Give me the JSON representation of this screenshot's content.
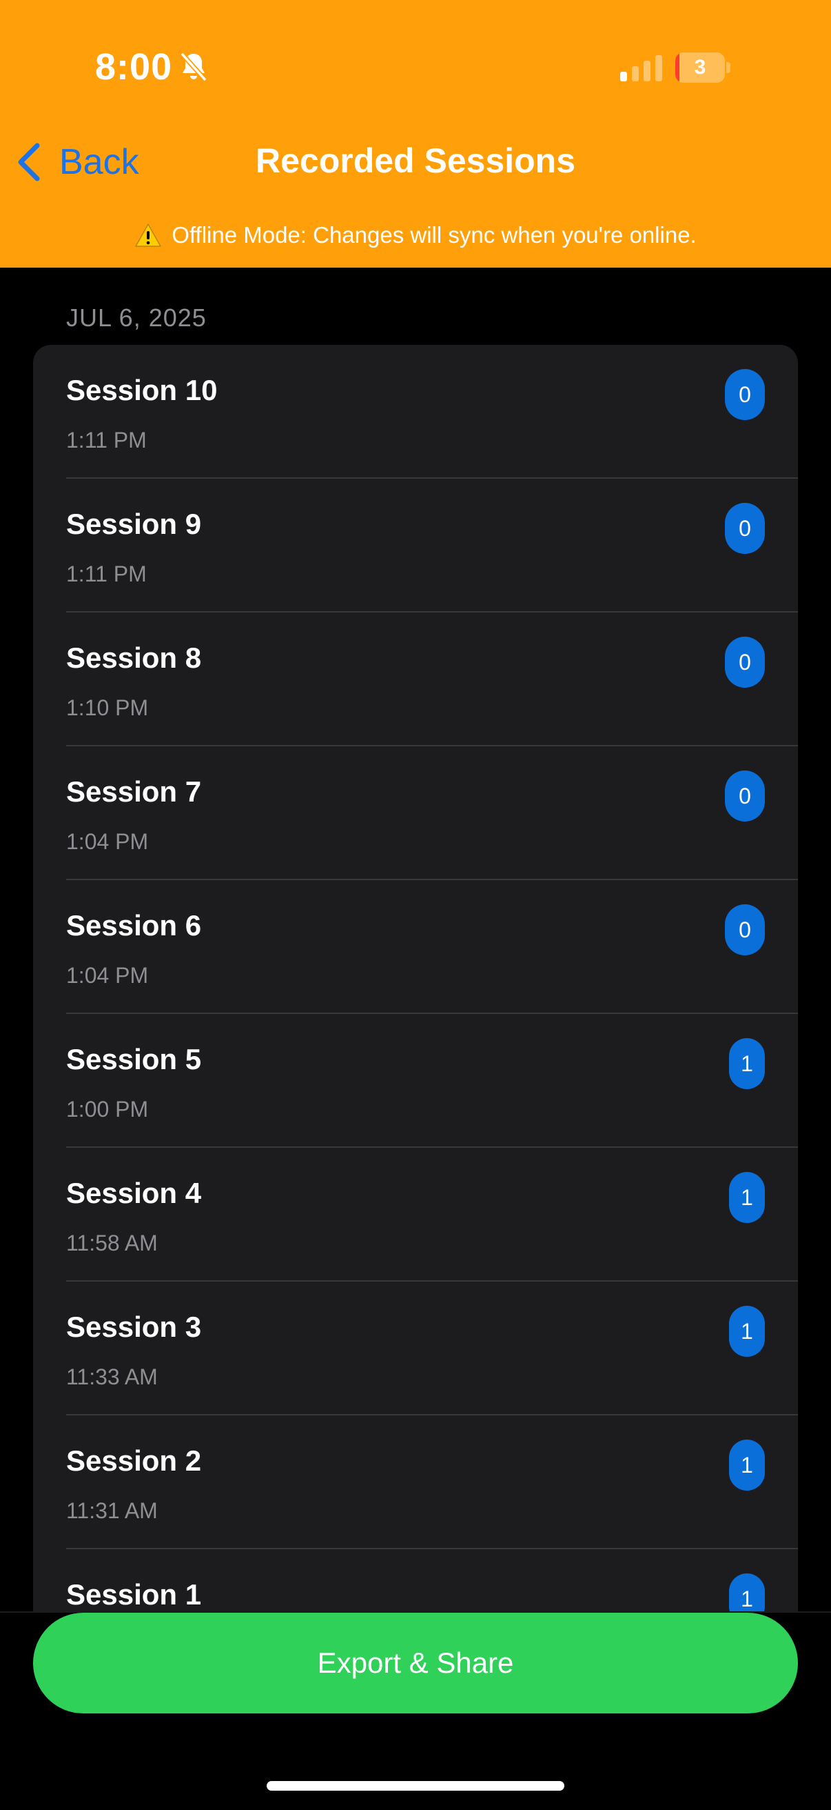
{
  "status_bar": {
    "time": "8:00",
    "battery_level": "3",
    "bell_icon": "bell-slash-icon",
    "signal_icon": "cellular-signal-icon"
  },
  "nav": {
    "back_label": "Back",
    "title": "Recorded Sessions"
  },
  "offline_banner": {
    "icon": "warning-icon",
    "text": "Offline Mode: Changes will sync when you're online."
  },
  "section": {
    "date_header": "JUL 6, 2025",
    "sessions": [
      {
        "title": "Session 10",
        "time": "1:11 PM",
        "count": "0"
      },
      {
        "title": "Session 9",
        "time": "1:11 PM",
        "count": "0"
      },
      {
        "title": "Session 8",
        "time": "1:10 PM",
        "count": "0"
      },
      {
        "title": "Session 7",
        "time": "1:04 PM",
        "count": "0"
      },
      {
        "title": "Session 6",
        "time": "1:04 PM",
        "count": "0"
      },
      {
        "title": "Session 5",
        "time": "1:00 PM",
        "count": "1"
      },
      {
        "title": "Session 4",
        "time": "11:58 AM",
        "count": "1"
      },
      {
        "title": "Session 3",
        "time": "11:33 AM",
        "count": "1"
      },
      {
        "title": "Session 2",
        "time": "11:31 AM",
        "count": "1"
      },
      {
        "title": "Session 1",
        "time": "",
        "count": "1"
      }
    ]
  },
  "actions": {
    "export_label": "Export & Share"
  },
  "colors": {
    "header_bg": "#FF9F0A",
    "accent_blue": "#1A73E8",
    "badge_blue": "#0A6FD8",
    "export_green": "#30D158",
    "card_bg": "#1C1C1E"
  }
}
